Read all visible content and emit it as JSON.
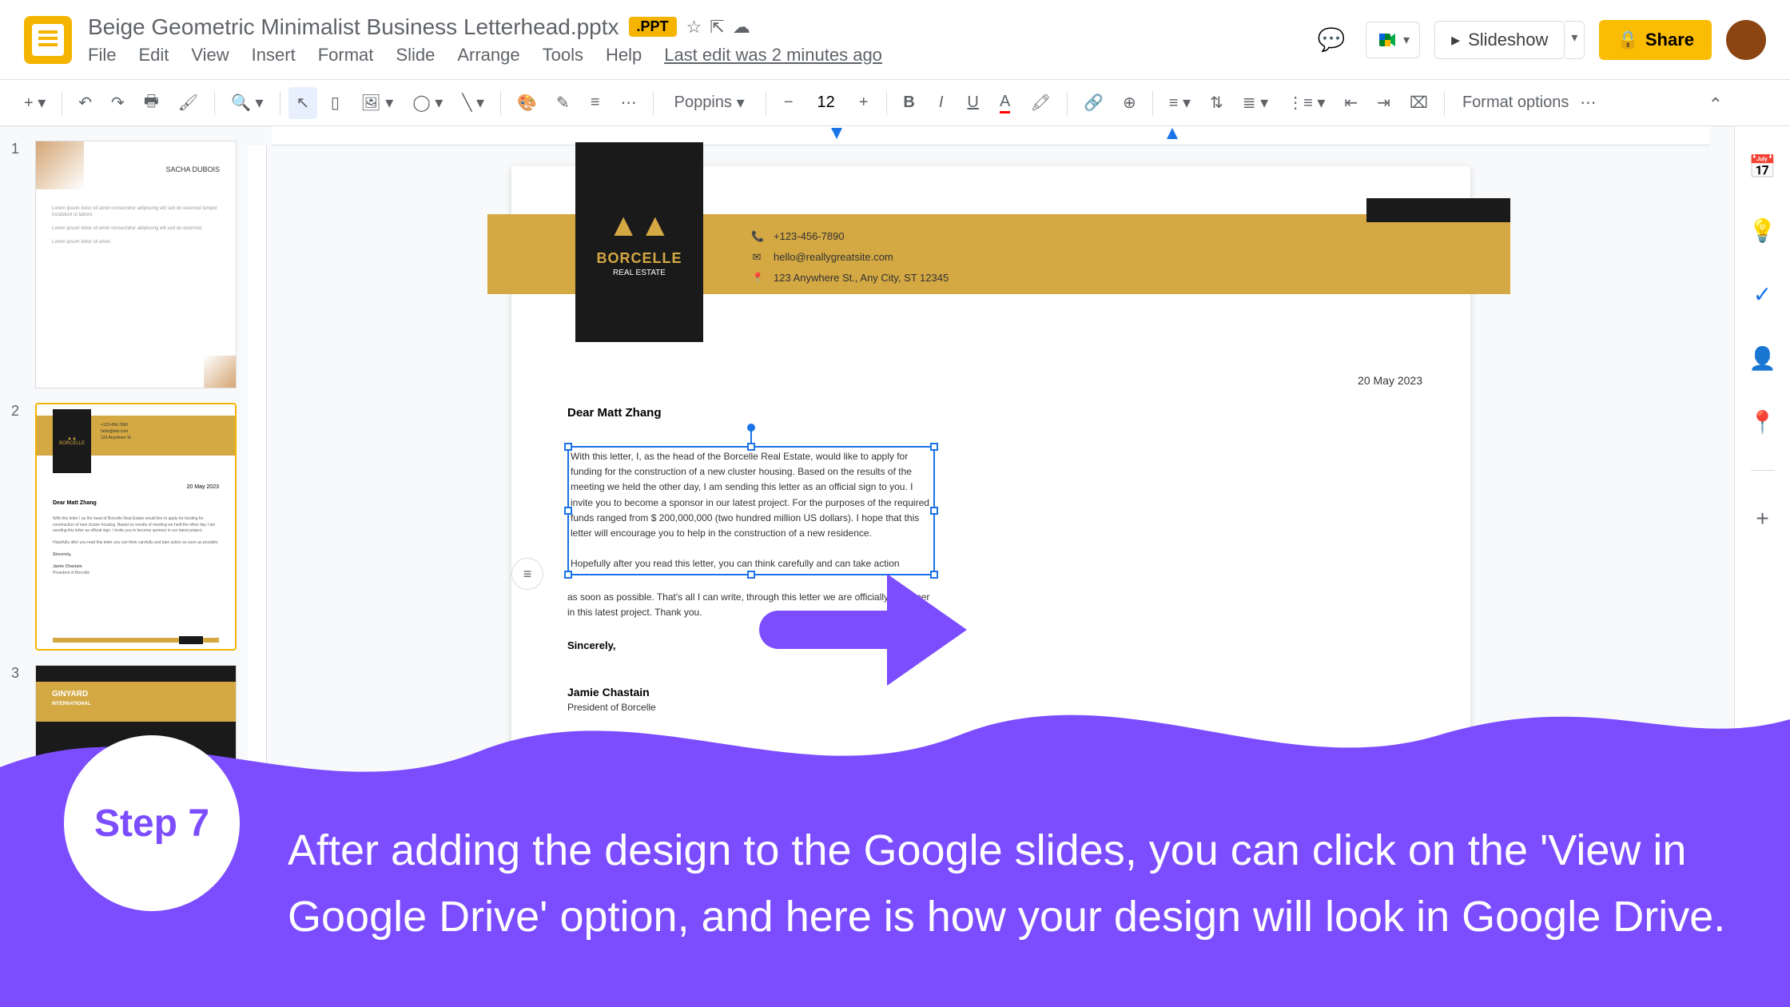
{
  "header": {
    "title": "Beige Geometric Minimalist Business Letterhead.pptx",
    "badge": ".PPT",
    "menus": [
      "File",
      "Edit",
      "View",
      "Insert",
      "Format",
      "Slide",
      "Arrange",
      "Tools",
      "Help"
    ],
    "last_edit": "Last edit was 2 minutes ago",
    "slideshow": "Slideshow",
    "share": "Share"
  },
  "toolbar": {
    "font": "Poppins",
    "font_size": "12",
    "format_options": "Format options"
  },
  "filmstrip": {
    "slide1": {
      "num": "1",
      "name": "SACHA DUBOIS"
    },
    "slide2": {
      "num": "2",
      "dear": "Dear Matt Zhang",
      "date": "20 May 2023",
      "brand": "BORCELLE"
    },
    "slide3": {
      "num": "3",
      "name": "GINYARD",
      "sub": "INTERNATIONAL"
    }
  },
  "letter": {
    "brand": "BORCELLE",
    "brand_sub": "REAL ESTATE",
    "phone": "+123-456-7890",
    "email": "hello@reallygreatsite.com",
    "address": "123 Anywhere St., Any City, ST 12345",
    "date": "20 May 2023",
    "greeting": "Dear Matt Zhang",
    "body1_a": "With this letter, I, as the head of the Borcelle Real Estate, would like to apply for funding for the construction of a new cluster housing. Based on the results of the meeting we held the other day, I am sending this letter as an official sign to you. I invite you to become a sponsor in our latest project. For the purposes of the required funds ranged from $ 200,000,000 (two hundred million US dollars).",
    "body1_b": "I hope that this letter will encourage you to help in the construction of a new residence.",
    "body1_c": "Hopefully after you read this letter, you can think carefully and can take action",
    "body2": "as soon as possible. That's all I can write, through this letter we are officially a partner in this latest project. Thank you.",
    "sincerely": "Sincerely,",
    "sig_name": "Jamie Chastain",
    "sig_title": "President of Borcelle"
  },
  "overlay": {
    "step": "Step 7",
    "text": "After adding the design to the Google slides, you can click on the 'View in Google Drive' option, and here is how your design will look in Google Drive."
  }
}
